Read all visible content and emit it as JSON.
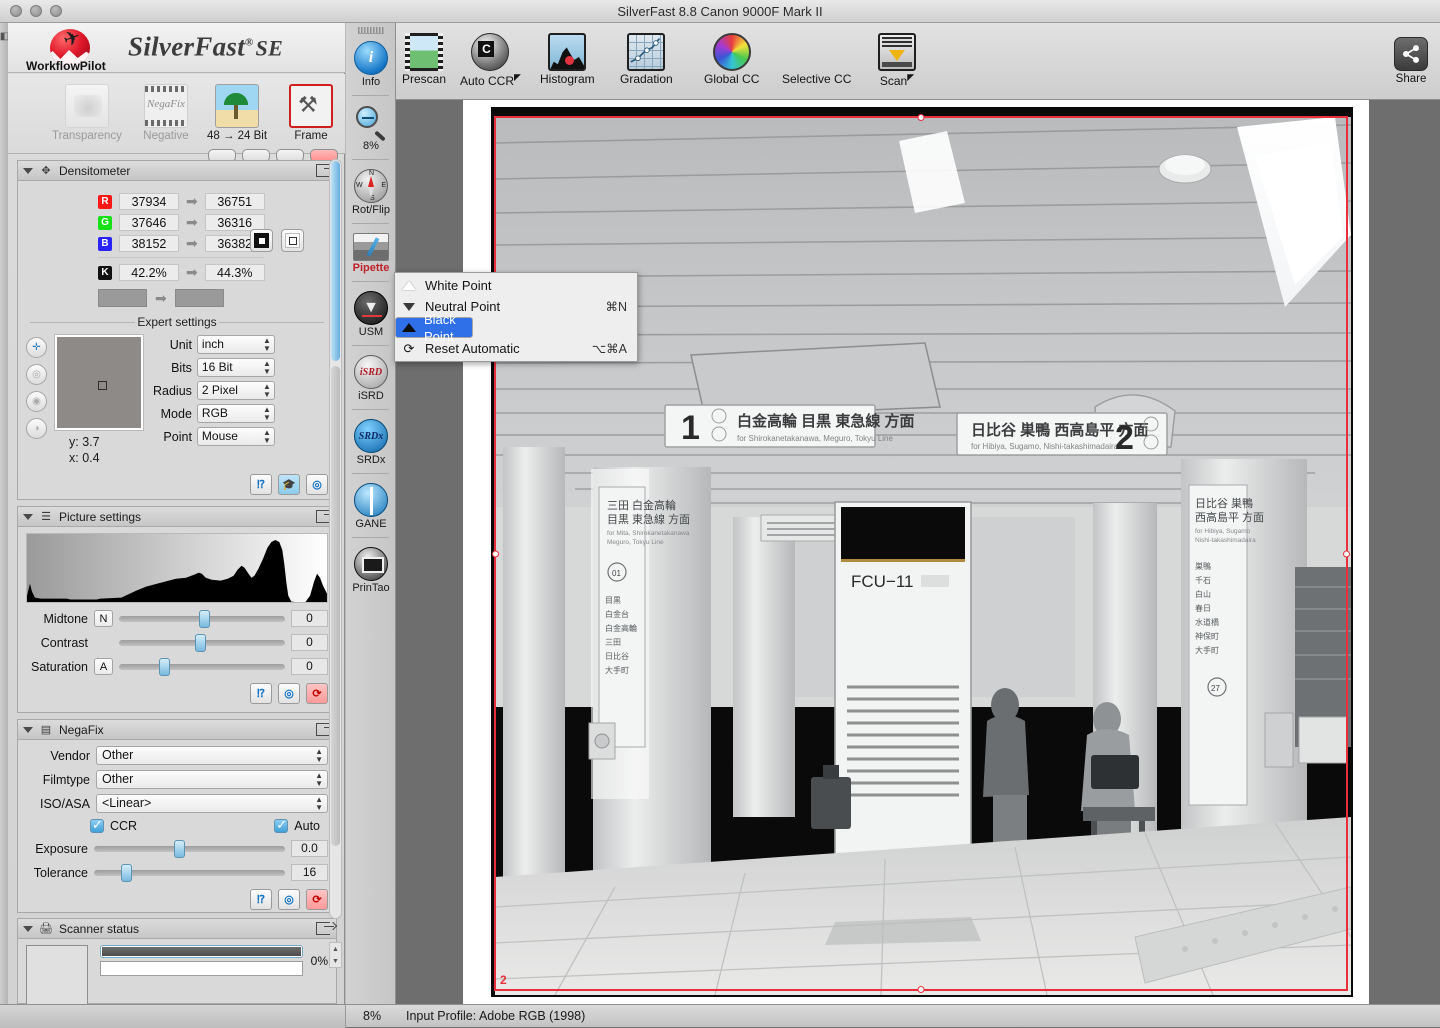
{
  "window": {
    "title": "SilverFast 8.8 Canon 9000F Mark II"
  },
  "brand": {
    "workflow_pilot": "WorkflowPilot",
    "name": "SilverFast",
    "registered": "®",
    "edition": "SE"
  },
  "mode_row": {
    "items": [
      {
        "label": "Transparency",
        "icon": "transparency-icon",
        "enabled": false,
        "selected": false
      },
      {
        "label": "Negative",
        "icon": "negafix-film-icon",
        "enabled": false,
        "selected": false
      },
      {
        "label": "48 → 24 Bit",
        "icon": "palm-image-icon",
        "enabled": true,
        "selected": false
      },
      {
        "label": "Frame",
        "icon": "frame-tools-icon",
        "enabled": true,
        "selected": true
      }
    ]
  },
  "densitometer": {
    "title": "Densitometer",
    "rows": [
      {
        "channel": "R",
        "before": "37934",
        "after": "36751",
        "color": "#ff1616"
      },
      {
        "channel": "G",
        "before": "37646",
        "after": "36316",
        "color": "#16e016"
      },
      {
        "channel": "B",
        "before": "38152",
        "after": "36382",
        "color": "#2a22ff"
      }
    ],
    "k_row": {
      "channel": "K",
      "before": "42.2%",
      "after": "44.3%",
      "color": "#111111"
    },
    "buttons": [
      {
        "name": "densitometer-dark-button"
      },
      {
        "name": "densitometer-light-button"
      }
    ],
    "expert": {
      "title": "Expert settings",
      "coords": {
        "y": "y: 3.7",
        "x": "x: 0.4"
      },
      "fields": [
        {
          "label": "Unit",
          "value": "inch"
        },
        {
          "label": "Bits",
          "value": "16 Bit"
        },
        {
          "label": "Radius",
          "value": "2 Pixel"
        },
        {
          "label": "Mode",
          "value": "RGB"
        },
        {
          "label": "Point",
          "value": "Mouse"
        }
      ],
      "help_buttons": [
        "?",
        "cap",
        "Q"
      ]
    }
  },
  "picture_settings": {
    "title": "Picture settings",
    "sliders": [
      {
        "label": "Midtone",
        "badge": "N",
        "value": "0",
        "pos": 50
      },
      {
        "label": "Contrast",
        "badge": "",
        "value": "0",
        "pos": 50
      },
      {
        "label": "Saturation",
        "badge": "A",
        "value": "0",
        "pos": 26
      }
    ],
    "help_buttons": [
      "?",
      "Q",
      "reset"
    ]
  },
  "negafix": {
    "title": "NegaFix",
    "selects": [
      {
        "label": "Vendor",
        "value": "Other"
      },
      {
        "label": "Filmtype",
        "value": "Other"
      },
      {
        "label": "ISO/ASA",
        "value": "<Linear>"
      }
    ],
    "checkboxes": [
      {
        "label": "CCR",
        "checked": true
      },
      {
        "label": "Auto",
        "checked": true
      }
    ],
    "sliders": [
      {
        "label": "Exposure",
        "value": "0.0",
        "pos": 42
      },
      {
        "label": "Tolerance",
        "value": "16",
        "pos": 16
      }
    ],
    "help_buttons": [
      "?",
      "Q",
      "reset"
    ]
  },
  "scanner_status": {
    "title": "Scanner status",
    "progress_percent": "0%",
    "progress_value": 100
  },
  "tool_strip": {
    "items": [
      {
        "label": "Info",
        "icon": "info-icon",
        "accent": false
      },
      {
        "label": "8%",
        "icon": "zoom-out-magnifier-icon",
        "accent": false
      },
      {
        "label": "Rot/Flip",
        "icon": "compass-rotate-flip-icon",
        "accent": false
      },
      {
        "label": "Pipette",
        "icon": "pipette-icon",
        "accent": true
      },
      {
        "label": "USM",
        "icon": "usm-icon",
        "accent": false
      },
      {
        "label": "iSRD",
        "icon": "isrd-icon",
        "accent": false
      },
      {
        "label": "SRDx",
        "icon": "srdx-icon",
        "accent": false
      },
      {
        "label": "GANE",
        "icon": "gane-icon",
        "accent": false
      },
      {
        "label": "PrinTao",
        "icon": "printao-icon",
        "accent": false
      }
    ]
  },
  "toolbar": {
    "items": [
      {
        "label": "Prescan",
        "icon": "prescan-film-icon",
        "superscript": ""
      },
      {
        "label": "Auto CCR",
        "icon": "auto-ccr-icon",
        "superscript": "⬌"
      },
      {
        "label": "Histogram",
        "icon": "histogram-icon",
        "superscript": ""
      },
      {
        "label": "Gradation",
        "icon": "gradation-curve-icon",
        "superscript": ""
      },
      {
        "label": "Global CC",
        "icon": "global-cc-color-wheel-icon",
        "superscript": ""
      },
      {
        "label": "Selective CC",
        "icon": "selective-cc-icon",
        "superscript": ""
      },
      {
        "label": "Scan",
        "icon": "scan-icon",
        "superscript": "⬌"
      }
    ],
    "share": {
      "label": "Share",
      "icon": "share-icon"
    }
  },
  "pipette_menu": {
    "items": [
      {
        "label": "White Point",
        "shortcut": "",
        "icon": "white-triangle-icon",
        "selected": false
      },
      {
        "label": "Neutral Point",
        "shortcut": "⌘N",
        "icon": "neutral-triangle-icon",
        "selected": false
      },
      {
        "label": "Black Point",
        "shortcut": "",
        "icon": "black-triangle-icon",
        "selected": true
      },
      {
        "label": "Reset Automatic",
        "shortcut": "⌥⌘A",
        "icon": "reset-circular-arrows-icon",
        "selected": false
      }
    ]
  },
  "preview": {
    "crop_labels": {
      "top_left": "",
      "bottom_left": "2"
    },
    "photo_text": {
      "unit_label": "FCU–11",
      "platform_1": "1",
      "platform_1_jp": "白金高輪 目黒 東急線 方面",
      "platform_1_en": "for Shirokanetakanawa, Meguro, Tokyu Line",
      "platform_2": "2",
      "platform_2_jp": "日比谷 巽鴨 西高島平 方面",
      "platform_2_en": "for Hibiya, Sugamo, Nishi-takashimadaira",
      "pillar_jp": "日比谷 巽鴨\n西高島平 方面",
      "pillar_en": "for Hibiya, Sugamo\nNishi-takashimadaira",
      "board_jp": "三田 白金高輪\n目黒 東急線 方面",
      "board_en": "for Mita, Shirokanetakanawa\nMeguro, Tokyu Line",
      "marker_01": "01",
      "marker_27": "27"
    }
  },
  "status_bar": {
    "zoom": "8%",
    "profile": "Input Profile: Adobe RGB (1998)"
  },
  "colors": {
    "accent_red": "#c0202a",
    "crop_red": "#e8303c",
    "menu_highlight": "#2f6fe8",
    "panel_bg": "#d9d9d9"
  }
}
